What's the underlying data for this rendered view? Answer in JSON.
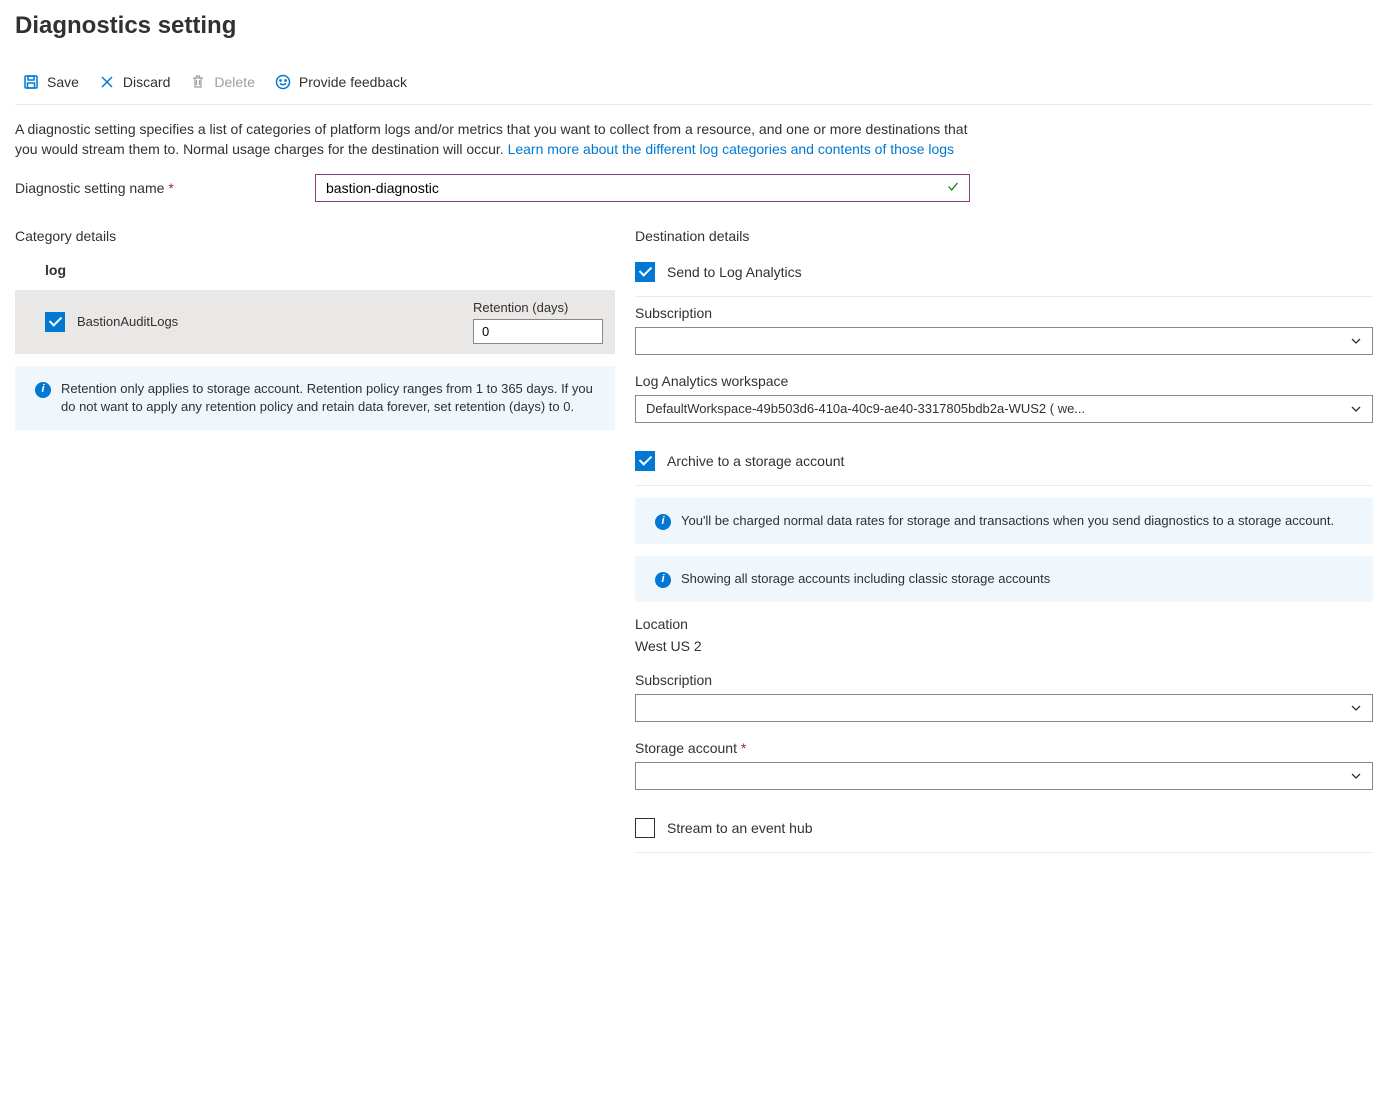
{
  "title": "Diagnostics setting",
  "toolbar": {
    "save": "Save",
    "discard": "Discard",
    "delete": "Delete",
    "feedback": "Provide feedback"
  },
  "description": {
    "text": "A diagnostic setting specifies a list of categories of platform logs and/or metrics that you want to collect from a resource, and one or more destinations that you would stream them to. Normal usage charges for the destination will occur. ",
    "link": "Learn more about the different log categories and contents of those logs"
  },
  "setting_name": {
    "label": "Diagnostic setting name",
    "value": "bastion-diagnostic"
  },
  "category": {
    "title": "Category details",
    "log_label": "log",
    "items": [
      {
        "name": "BastionAuditLogs",
        "checked": true
      }
    ],
    "retention_label": "Retention (days)",
    "retention_value": "0",
    "info": "Retention only applies to storage account. Retention policy ranges from 1 to 365 days. If you do not want to apply any retention policy and retain data forever, set retention (days) to 0."
  },
  "destination": {
    "title": "Destination details",
    "log_analytics": {
      "label": "Send to Log Analytics",
      "checked": true,
      "subscription_label": "Subscription",
      "subscription_value": "",
      "workspace_label": "Log Analytics workspace",
      "workspace_value": "DefaultWorkspace-49b503d6-410a-40c9-ae40-3317805bdb2a-WUS2 ( we..."
    },
    "storage": {
      "label": "Archive to a storage account",
      "checked": true,
      "info1": "You'll be charged normal data rates for storage and transactions when you send diagnostics to a storage account.",
      "info2": "Showing all storage accounts including classic storage accounts",
      "location_label": "Location",
      "location_value": "West US 2",
      "subscription_label": "Subscription",
      "subscription_value": "",
      "account_label": "Storage account",
      "account_value": ""
    },
    "event_hub": {
      "label": "Stream to an event hub",
      "checked": false
    }
  }
}
